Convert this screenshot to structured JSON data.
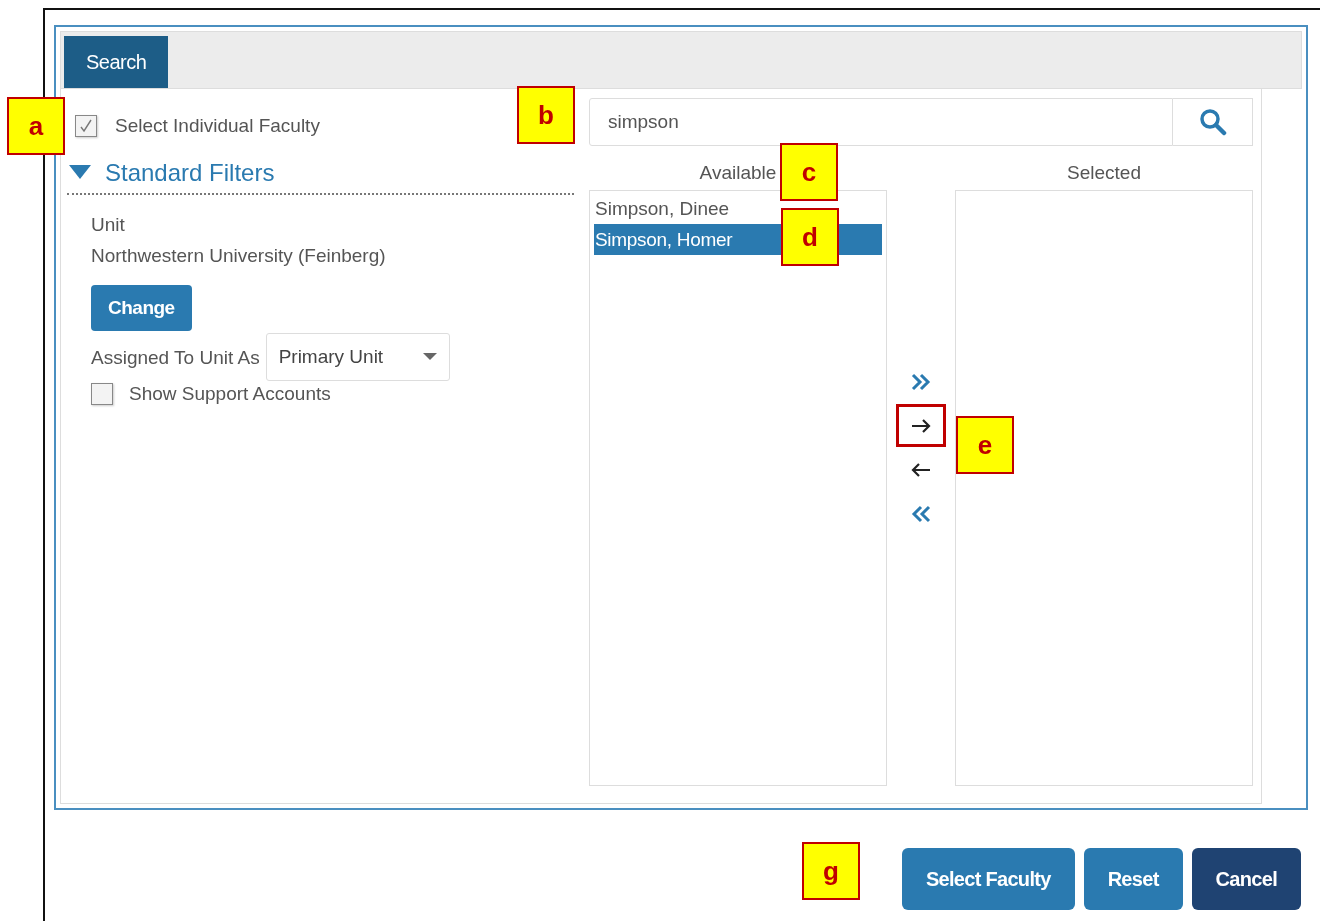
{
  "tabs": [
    {
      "label": "Search",
      "selected": true
    }
  ],
  "select_individual": {
    "label": "Select Individual Faculty",
    "checked": true
  },
  "filters": {
    "title": "Standard Filters",
    "expanded": true,
    "unit_label": "Unit",
    "unit_value": "Northwestern University (Feinberg)",
    "change_button": "Change",
    "assigned_label": "Assigned To Unit As",
    "assigned_value": "Primary Unit",
    "support": {
      "label": "Show Support Accounts",
      "checked": false
    }
  },
  "search": {
    "value": "simpson"
  },
  "available": {
    "title": "Available",
    "items": [
      {
        "label": "Simpson, Dinee",
        "selected": false
      },
      {
        "label": "Simpson, Homer",
        "selected": true
      }
    ]
  },
  "selected_title": "Selected",
  "move_buttons": [
    {
      "kind": "add-all",
      "highlighted": false
    },
    {
      "kind": "add",
      "highlighted": true
    },
    {
      "kind": "remove",
      "highlighted": false
    },
    {
      "kind": "remove-all",
      "highlighted": false
    }
  ],
  "buttons": [
    {
      "label": "Select Faculty",
      "kind": "primary"
    },
    {
      "label": "Reset",
      "kind": "primary"
    },
    {
      "label": "Cancel",
      "kind": "dark"
    }
  ],
  "callouts": [
    {
      "label": "a"
    },
    {
      "label": "b"
    },
    {
      "label": "c"
    },
    {
      "label": "d"
    },
    {
      "label": "e"
    },
    {
      "label": "g"
    }
  ]
}
